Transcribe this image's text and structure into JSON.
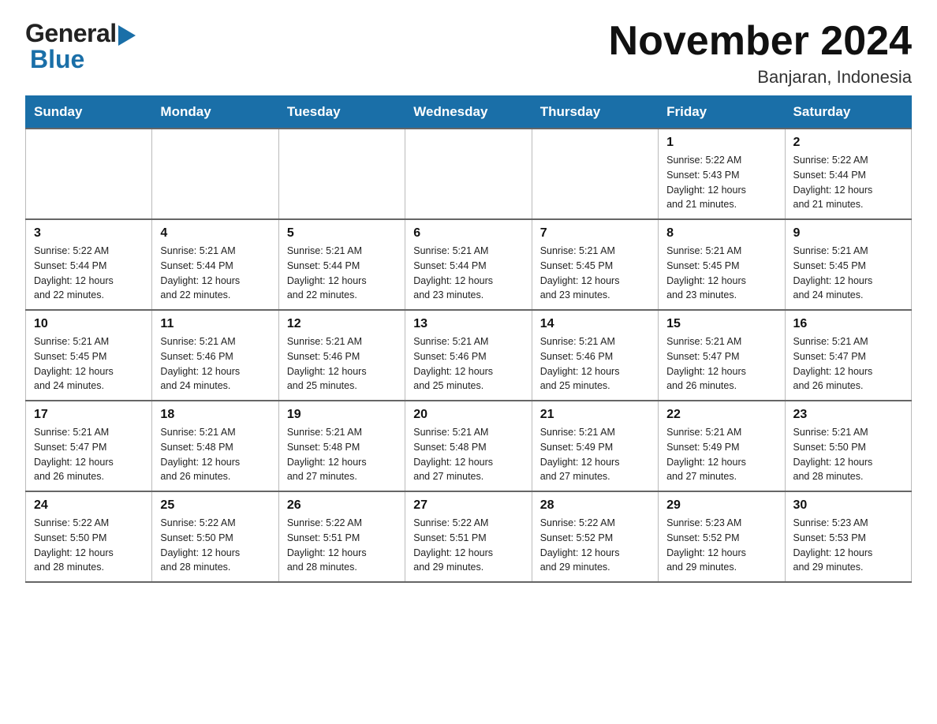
{
  "header": {
    "logo_general": "General",
    "logo_blue": "Blue",
    "title": "November 2024",
    "subtitle": "Banjaran, Indonesia"
  },
  "weekdays": [
    "Sunday",
    "Monday",
    "Tuesday",
    "Wednesday",
    "Thursday",
    "Friday",
    "Saturday"
  ],
  "weeks": [
    [
      {
        "day": "",
        "info": ""
      },
      {
        "day": "",
        "info": ""
      },
      {
        "day": "",
        "info": ""
      },
      {
        "day": "",
        "info": ""
      },
      {
        "day": "",
        "info": ""
      },
      {
        "day": "1",
        "info": "Sunrise: 5:22 AM\nSunset: 5:43 PM\nDaylight: 12 hours\nand 21 minutes."
      },
      {
        "day": "2",
        "info": "Sunrise: 5:22 AM\nSunset: 5:44 PM\nDaylight: 12 hours\nand 21 minutes."
      }
    ],
    [
      {
        "day": "3",
        "info": "Sunrise: 5:22 AM\nSunset: 5:44 PM\nDaylight: 12 hours\nand 22 minutes."
      },
      {
        "day": "4",
        "info": "Sunrise: 5:21 AM\nSunset: 5:44 PM\nDaylight: 12 hours\nand 22 minutes."
      },
      {
        "day": "5",
        "info": "Sunrise: 5:21 AM\nSunset: 5:44 PM\nDaylight: 12 hours\nand 22 minutes."
      },
      {
        "day": "6",
        "info": "Sunrise: 5:21 AM\nSunset: 5:44 PM\nDaylight: 12 hours\nand 23 minutes."
      },
      {
        "day": "7",
        "info": "Sunrise: 5:21 AM\nSunset: 5:45 PM\nDaylight: 12 hours\nand 23 minutes."
      },
      {
        "day": "8",
        "info": "Sunrise: 5:21 AM\nSunset: 5:45 PM\nDaylight: 12 hours\nand 23 minutes."
      },
      {
        "day": "9",
        "info": "Sunrise: 5:21 AM\nSunset: 5:45 PM\nDaylight: 12 hours\nand 24 minutes."
      }
    ],
    [
      {
        "day": "10",
        "info": "Sunrise: 5:21 AM\nSunset: 5:45 PM\nDaylight: 12 hours\nand 24 minutes."
      },
      {
        "day": "11",
        "info": "Sunrise: 5:21 AM\nSunset: 5:46 PM\nDaylight: 12 hours\nand 24 minutes."
      },
      {
        "day": "12",
        "info": "Sunrise: 5:21 AM\nSunset: 5:46 PM\nDaylight: 12 hours\nand 25 minutes."
      },
      {
        "day": "13",
        "info": "Sunrise: 5:21 AM\nSunset: 5:46 PM\nDaylight: 12 hours\nand 25 minutes."
      },
      {
        "day": "14",
        "info": "Sunrise: 5:21 AM\nSunset: 5:46 PM\nDaylight: 12 hours\nand 25 minutes."
      },
      {
        "day": "15",
        "info": "Sunrise: 5:21 AM\nSunset: 5:47 PM\nDaylight: 12 hours\nand 26 minutes."
      },
      {
        "day": "16",
        "info": "Sunrise: 5:21 AM\nSunset: 5:47 PM\nDaylight: 12 hours\nand 26 minutes."
      }
    ],
    [
      {
        "day": "17",
        "info": "Sunrise: 5:21 AM\nSunset: 5:47 PM\nDaylight: 12 hours\nand 26 minutes."
      },
      {
        "day": "18",
        "info": "Sunrise: 5:21 AM\nSunset: 5:48 PM\nDaylight: 12 hours\nand 26 minutes."
      },
      {
        "day": "19",
        "info": "Sunrise: 5:21 AM\nSunset: 5:48 PM\nDaylight: 12 hours\nand 27 minutes."
      },
      {
        "day": "20",
        "info": "Sunrise: 5:21 AM\nSunset: 5:48 PM\nDaylight: 12 hours\nand 27 minutes."
      },
      {
        "day": "21",
        "info": "Sunrise: 5:21 AM\nSunset: 5:49 PM\nDaylight: 12 hours\nand 27 minutes."
      },
      {
        "day": "22",
        "info": "Sunrise: 5:21 AM\nSunset: 5:49 PM\nDaylight: 12 hours\nand 27 minutes."
      },
      {
        "day": "23",
        "info": "Sunrise: 5:21 AM\nSunset: 5:50 PM\nDaylight: 12 hours\nand 28 minutes."
      }
    ],
    [
      {
        "day": "24",
        "info": "Sunrise: 5:22 AM\nSunset: 5:50 PM\nDaylight: 12 hours\nand 28 minutes."
      },
      {
        "day": "25",
        "info": "Sunrise: 5:22 AM\nSunset: 5:50 PM\nDaylight: 12 hours\nand 28 minutes."
      },
      {
        "day": "26",
        "info": "Sunrise: 5:22 AM\nSunset: 5:51 PM\nDaylight: 12 hours\nand 28 minutes."
      },
      {
        "day": "27",
        "info": "Sunrise: 5:22 AM\nSunset: 5:51 PM\nDaylight: 12 hours\nand 29 minutes."
      },
      {
        "day": "28",
        "info": "Sunrise: 5:22 AM\nSunset: 5:52 PM\nDaylight: 12 hours\nand 29 minutes."
      },
      {
        "day": "29",
        "info": "Sunrise: 5:23 AM\nSunset: 5:52 PM\nDaylight: 12 hours\nand 29 minutes."
      },
      {
        "day": "30",
        "info": "Sunrise: 5:23 AM\nSunset: 5:53 PM\nDaylight: 12 hours\nand 29 minutes."
      }
    ]
  ]
}
